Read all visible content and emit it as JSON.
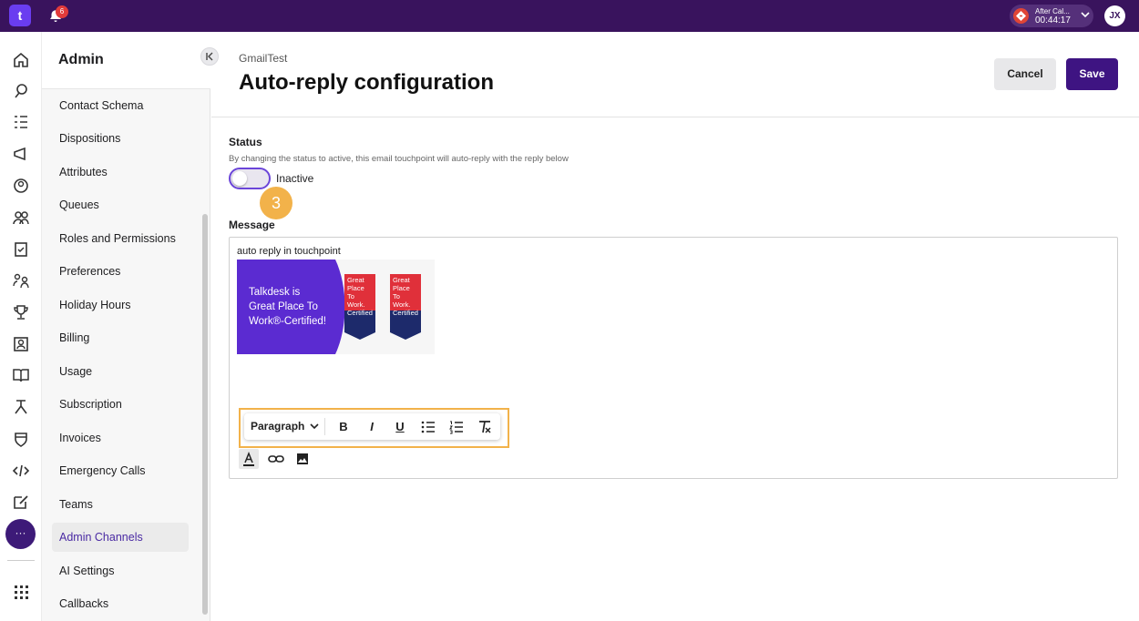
{
  "topbar": {
    "logo_glyph": "t",
    "notification_count": "6",
    "call": {
      "title": "After Cal...",
      "timer": "00:44:17"
    },
    "avatar_initials": "JX"
  },
  "rail": {
    "icons": [
      "home-icon",
      "conversations-icon",
      "tasks-icon",
      "campaigns-icon",
      "contacts-icon",
      "teams-icon",
      "clipboard-icon",
      "people-icon",
      "trophy-icon",
      "contact-card-icon",
      "knowledge-book-icon",
      "workflow-icon",
      "shield-icon",
      "code-icon",
      "edit-icon"
    ],
    "more_label": "···",
    "apps_icon": "grid-icon"
  },
  "sidebar": {
    "title": "Admin",
    "items": [
      {
        "label": "Contact Schema"
      },
      {
        "label": "Dispositions"
      },
      {
        "label": "Attributes"
      },
      {
        "label": "Queues"
      },
      {
        "label": "Roles and Permissions"
      },
      {
        "label": "Preferences"
      },
      {
        "label": "Holiday Hours"
      },
      {
        "label": "Billing"
      },
      {
        "label": "Usage"
      },
      {
        "label": "Subscription"
      },
      {
        "label": "Invoices"
      },
      {
        "label": "Emergency Calls"
      },
      {
        "label": "Teams"
      },
      {
        "label": "Admin Channels",
        "active": true
      },
      {
        "label": "AI Settings"
      },
      {
        "label": "Callbacks"
      }
    ]
  },
  "header": {
    "breadcrumb": "GmailTest",
    "title": "Auto-reply configuration",
    "cancel_label": "Cancel",
    "save_label": "Save"
  },
  "status": {
    "label": "Status",
    "description": "By changing the status to active, this email touchpoint will auto-reply with the reply below",
    "toggle_value": "Inactive",
    "toggle_on": false
  },
  "step_badge": "3",
  "message": {
    "label": "Message",
    "body_text": "auto reply in touchpoint",
    "banner": {
      "line1": "Talkdesk is",
      "line2": "Great Place To",
      "line3": "Work®-Certified!",
      "badge_text": [
        "Great",
        "Place",
        "To",
        "Work.",
        "Certified"
      ]
    },
    "toolbar": {
      "paragraph_label": "Paragraph",
      "bold": "B",
      "italic": "I",
      "underline": "U"
    }
  },
  "colors": {
    "topbar": "#39135d",
    "accent": "#3e1482",
    "highlight": "#f2b24a",
    "toggle_border": "#6b45d9"
  }
}
